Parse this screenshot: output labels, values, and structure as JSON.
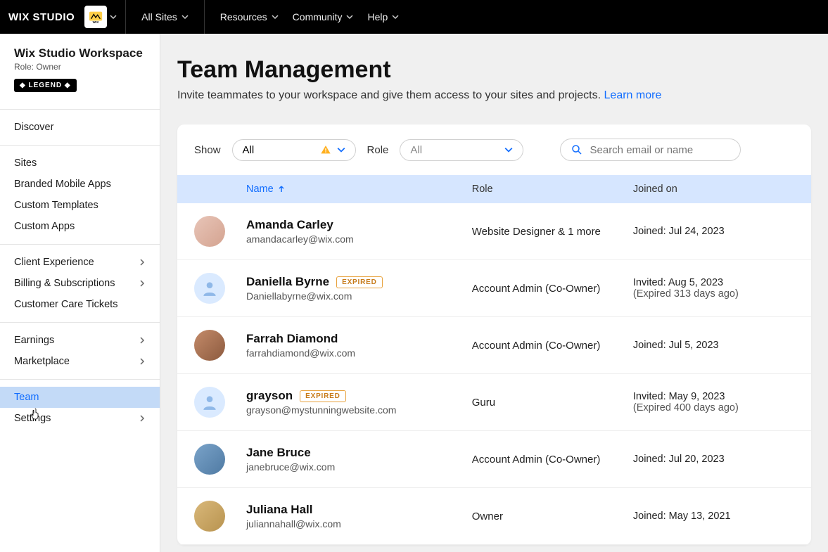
{
  "topnav": {
    "logo": "WIX STUDIO",
    "items": [
      "All Sites",
      "Resources",
      "Community",
      "Help"
    ]
  },
  "sidebar": {
    "title": "Wix Studio Workspace",
    "role": "Role: Owner",
    "badge": "◆ LEGEND ◆",
    "groups": [
      {
        "items": [
          {
            "label": "Discover"
          }
        ]
      },
      {
        "items": [
          {
            "label": "Sites"
          },
          {
            "label": "Branded Mobile Apps"
          },
          {
            "label": "Custom Templates"
          },
          {
            "label": "Custom Apps"
          }
        ]
      },
      {
        "items": [
          {
            "label": "Client Experience",
            "chev": true
          },
          {
            "label": "Billing & Subscriptions",
            "chev": true
          },
          {
            "label": "Customer Care Tickets"
          }
        ]
      },
      {
        "items": [
          {
            "label": "Earnings",
            "chev": true
          },
          {
            "label": "Marketplace",
            "chev": true
          }
        ]
      },
      {
        "items": [
          {
            "label": "Team",
            "active": true
          },
          {
            "label": "Settings",
            "chev": true
          }
        ]
      }
    ]
  },
  "page": {
    "title": "Team Management",
    "subtitle": "Invite teammates to your workspace and give them access to your sites and projects. ",
    "learn_more": "Learn more"
  },
  "filters": {
    "show_label": "Show",
    "show_value": "All",
    "role_label": "Role",
    "role_value": "All",
    "search_placeholder": "Search email or name"
  },
  "table": {
    "headers": {
      "name": "Name",
      "role": "Role",
      "joined": "Joined on"
    },
    "rows": [
      {
        "name": "Amanda Carley",
        "email": "amandacarley@wix.com",
        "role": "Website Designer & 1 more",
        "joined_line1": "Joined: Jul 24, 2023",
        "avatar": "img1"
      },
      {
        "name": "Daniella Byrne",
        "email": "Daniellabyrne@wix.com",
        "expired": "EXPIRED",
        "role": "Account Admin (Co-Owner)",
        "joined_line1": "Invited: Aug 5, 2023",
        "joined_line2": "(Expired 313 days ago)",
        "avatar": "ph"
      },
      {
        "name": "Farrah Diamond",
        "email": "farrahdiamond@wix.com",
        "role": "Account Admin (Co-Owner)",
        "joined_line1": "Joined: Jul 5, 2023",
        "avatar": "img2"
      },
      {
        "name": "grayson",
        "email": "grayson@mystunningwebsite.com",
        "expired": "EXPIRED",
        "role": "Guru",
        "joined_line1": "Invited: May 9, 2023",
        "joined_line2": "(Expired 400 days ago)",
        "avatar": "ph"
      },
      {
        "name": "Jane Bruce",
        "email": "janebruce@wix.com",
        "role": "Account Admin (Co-Owner)",
        "joined_line1": "Joined: Jul 20, 2023",
        "avatar": "img3"
      },
      {
        "name": "Juliana Hall",
        "email": "juliannahall@wix.com",
        "role": "Owner",
        "joined_line1": "Joined: May 13, 2021",
        "avatar": "img4"
      }
    ]
  }
}
